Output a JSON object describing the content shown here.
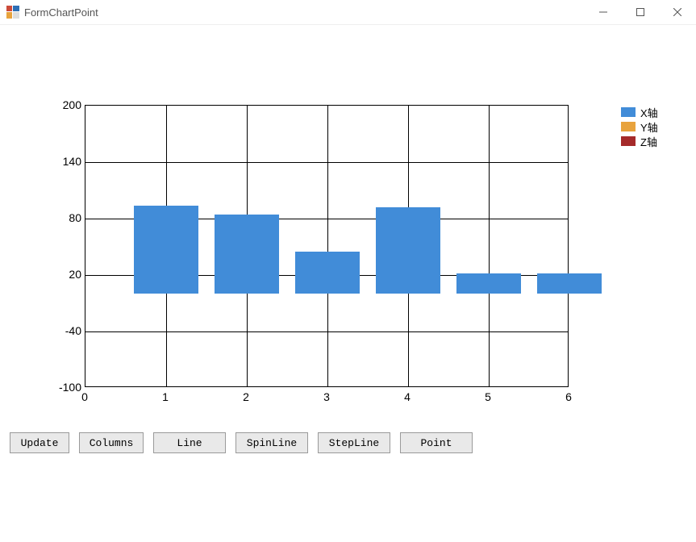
{
  "window": {
    "title": "FormChartPoint"
  },
  "chart_data": {
    "type": "bar",
    "categories": [
      "1",
      "2",
      "3",
      "4",
      "5",
      "6"
    ],
    "series": [
      {
        "name": "X轴",
        "color": "#418CD8",
        "values": [
          94,
          84,
          45,
          92,
          22,
          22
        ]
      },
      {
        "name": "Y轴",
        "color": "#E8A33D",
        "values": []
      },
      {
        "name": "Z轴",
        "color": "#A52A2A",
        "values": []
      }
    ],
    "xlabel": "",
    "ylabel": "",
    "ylim": [
      -100,
      200
    ],
    "yticks": [
      -100,
      -40,
      20,
      80,
      140,
      200
    ],
    "xlim": [
      0,
      6
    ],
    "xticks": [
      0,
      1,
      2,
      3,
      4,
      5,
      6
    ],
    "grid": true
  },
  "buttons": {
    "update": "Update",
    "columns": "Columns",
    "line": "Line",
    "spinline": "SpinLine",
    "stepline": "StepLine",
    "point": "Point"
  }
}
